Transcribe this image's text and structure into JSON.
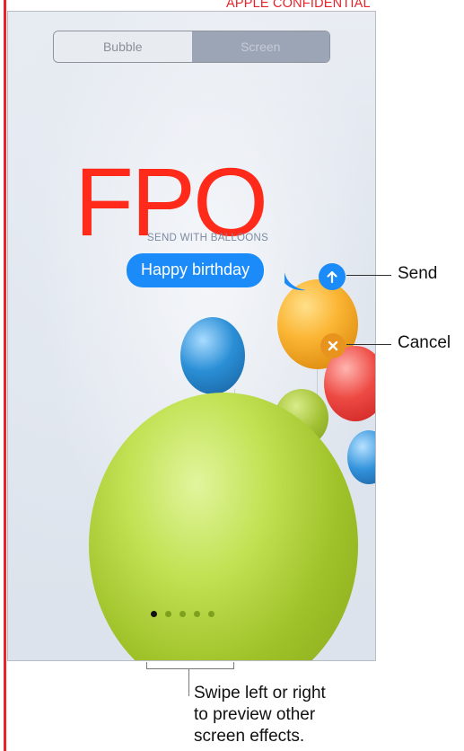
{
  "watermark": "APPLE CONFIDENTIAL",
  "segmented_control": {
    "options": [
      "Bubble",
      "Screen"
    ],
    "selected": "Screen"
  },
  "placeholder": {
    "fpo": "FPO",
    "send_with": "SEND WITH BALLOONS"
  },
  "message": {
    "text": "Happy birthday"
  },
  "callouts": {
    "send": "Send",
    "cancel": "Cancel"
  },
  "page_indicator": {
    "count": 5,
    "active_index": 0
  },
  "caption": [
    "Swipe left or right",
    "to preview other",
    "screen effects."
  ],
  "colors": {
    "accent": "#1b8bfa",
    "fpo": "#ff2a1a",
    "watermark": "#e8232a",
    "cancel": "#e9931f"
  },
  "icons": {
    "send": "arrow-up-icon",
    "cancel": "x-icon"
  }
}
